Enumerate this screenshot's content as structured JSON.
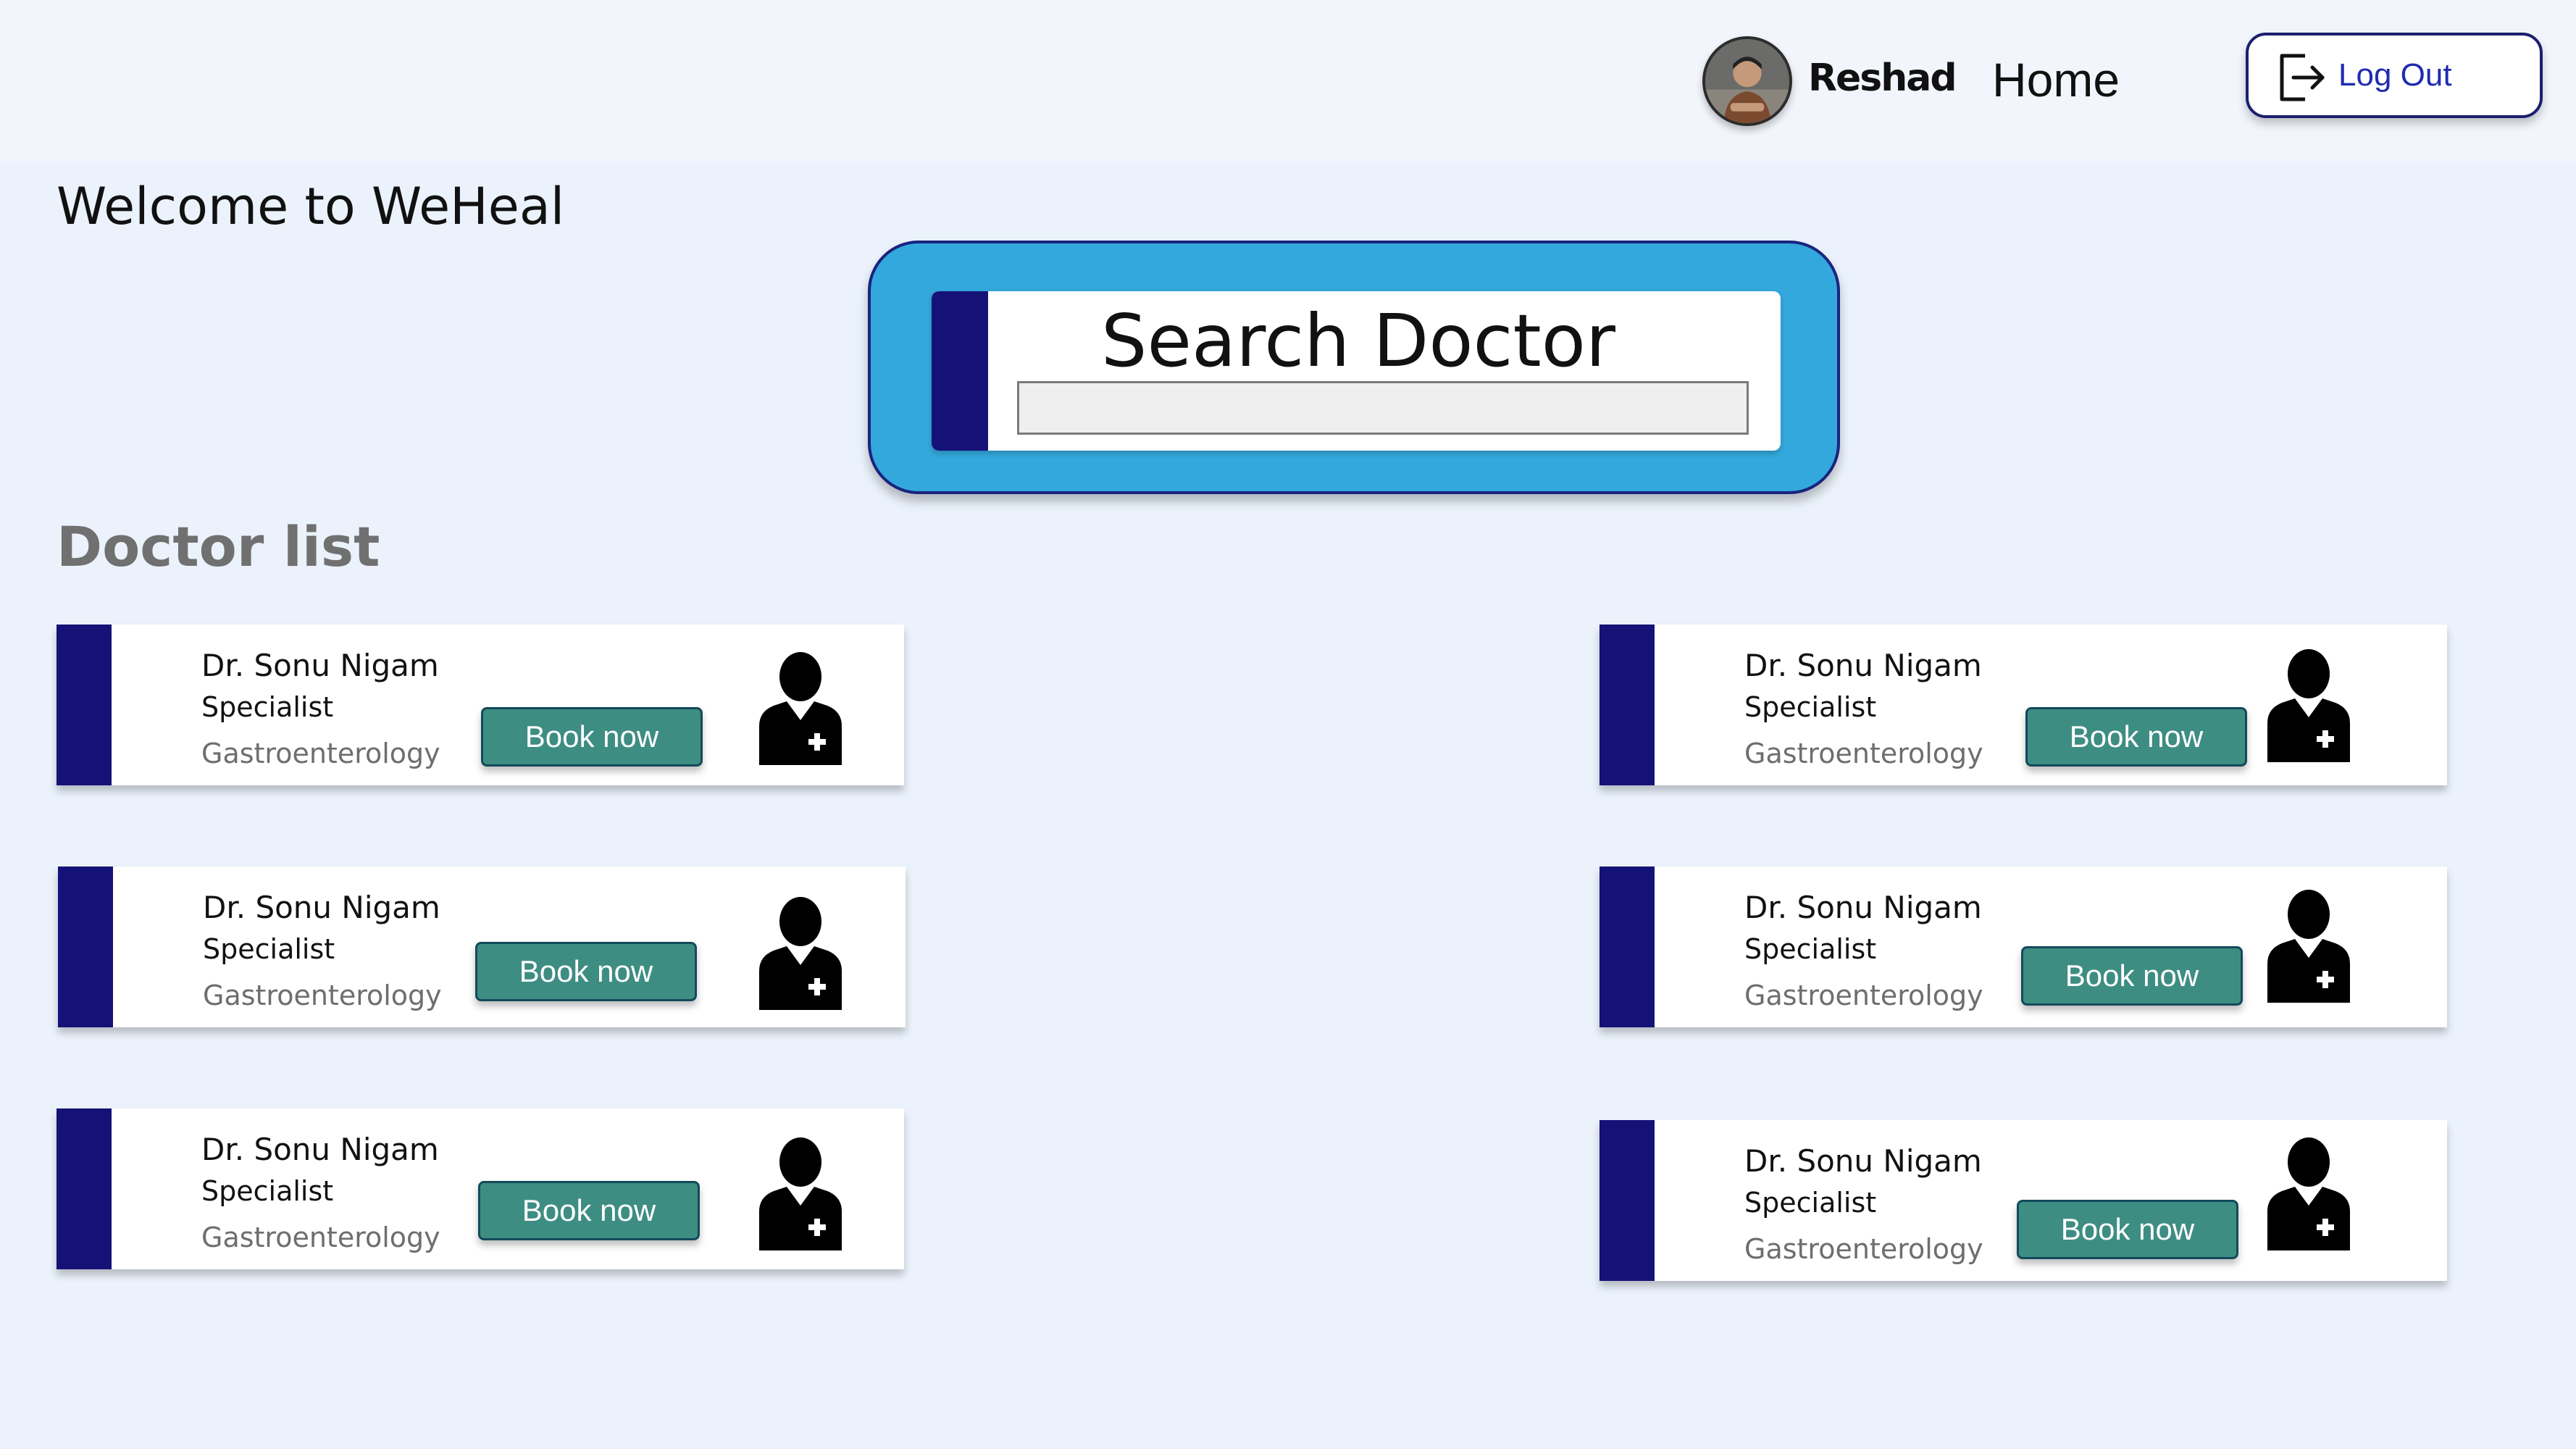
{
  "header": {
    "user_name": "Reshad",
    "nav_home": "Home",
    "logout_label": "Log Out"
  },
  "welcome": "Welcome to WeHeal",
  "search": {
    "title": "Search Doctor",
    "value": ""
  },
  "doctor_list_title": "Doctor list",
  "doctors": [
    {
      "name": "Dr. Sonu Nigam",
      "role": "Specialist",
      "department": "Gastroenterology",
      "action": "Book now"
    },
    {
      "name": "Dr. Sonu Nigam",
      "role": "Specialist",
      "department": "Gastroenterology",
      "action": "Book now"
    },
    {
      "name": "Dr. Sonu Nigam",
      "role": "Specialist",
      "department": "Gastroenterology",
      "action": "Book now"
    },
    {
      "name": "Dr. Sonu Nigam",
      "role": "Specialist",
      "department": "Gastroenterology",
      "action": "Book now"
    },
    {
      "name": "Dr. Sonu Nigam",
      "role": "Specialist",
      "department": "Gastroenterology",
      "action": "Book now"
    },
    {
      "name": "Dr. Sonu Nigam",
      "role": "Specialist",
      "department": "Gastroenterology",
      "action": "Book now"
    }
  ],
  "colors": {
    "background": "#ebf2fb",
    "accent_navy": "#151277",
    "search_blue": "#33a8dc",
    "book_button": "#3e8d83",
    "logout_text": "#1f2bb0"
  },
  "icons": {
    "avatar": "user-photo",
    "logout": "logout-icon",
    "doctor": "doctor-icon"
  }
}
